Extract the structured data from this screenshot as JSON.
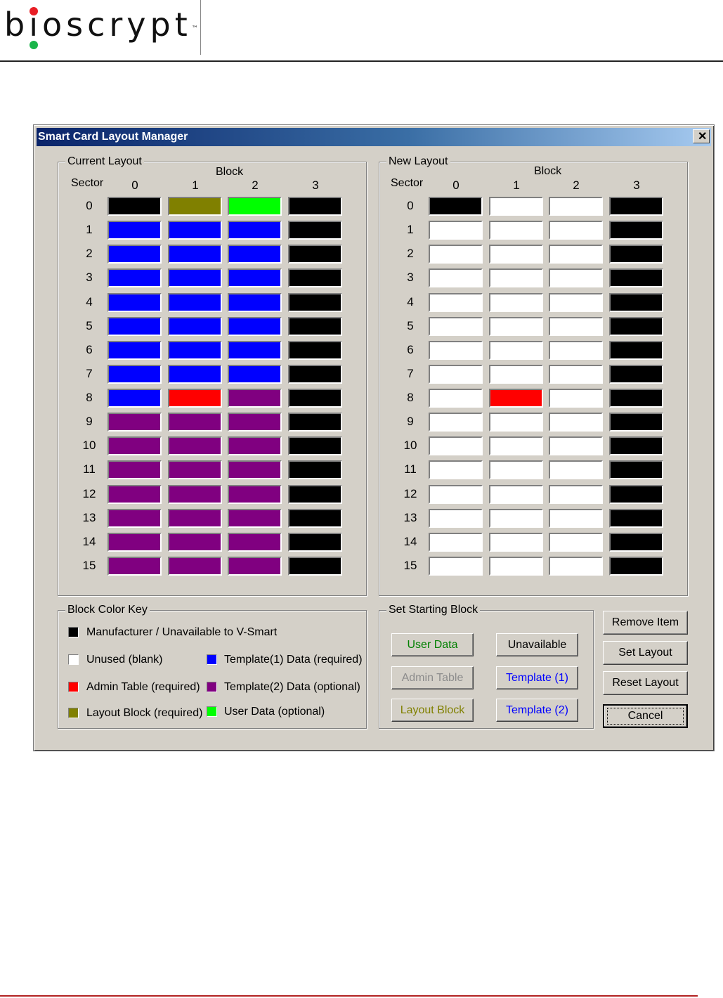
{
  "header": {
    "logo_text": "bioscrypt",
    "logo_tm": "™"
  },
  "dialog": {
    "title": "Smart Card Layout Manager",
    "close_label": "✕",
    "current_layout": {
      "title": "Current Layout",
      "block_label": "Block",
      "sector_label": "Sector",
      "columns": [
        "0",
        "1",
        "2",
        "3"
      ],
      "rows": [
        {
          "sector": "0",
          "cells": [
            "#000000",
            "#808000",
            "#00ff00",
            "#000000"
          ]
        },
        {
          "sector": "1",
          "cells": [
            "#0000ff",
            "#0000ff",
            "#0000ff",
            "#000000"
          ]
        },
        {
          "sector": "2",
          "cells": [
            "#0000ff",
            "#0000ff",
            "#0000ff",
            "#000000"
          ]
        },
        {
          "sector": "3",
          "cells": [
            "#0000ff",
            "#0000ff",
            "#0000ff",
            "#000000"
          ]
        },
        {
          "sector": "4",
          "cells": [
            "#0000ff",
            "#0000ff",
            "#0000ff",
            "#000000"
          ]
        },
        {
          "sector": "5",
          "cells": [
            "#0000ff",
            "#0000ff",
            "#0000ff",
            "#000000"
          ]
        },
        {
          "sector": "6",
          "cells": [
            "#0000ff",
            "#0000ff",
            "#0000ff",
            "#000000"
          ]
        },
        {
          "sector": "7",
          "cells": [
            "#0000ff",
            "#0000ff",
            "#0000ff",
            "#000000"
          ]
        },
        {
          "sector": "8",
          "cells": [
            "#0000ff",
            "#ff0000",
            "#800080",
            "#000000"
          ]
        },
        {
          "sector": "9",
          "cells": [
            "#800080",
            "#800080",
            "#800080",
            "#000000"
          ]
        },
        {
          "sector": "10",
          "cells": [
            "#800080",
            "#800080",
            "#800080",
            "#000000"
          ]
        },
        {
          "sector": "11",
          "cells": [
            "#800080",
            "#800080",
            "#800080",
            "#000000"
          ]
        },
        {
          "sector": "12",
          "cells": [
            "#800080",
            "#800080",
            "#800080",
            "#000000"
          ]
        },
        {
          "sector": "13",
          "cells": [
            "#800080",
            "#800080",
            "#800080",
            "#000000"
          ]
        },
        {
          "sector": "14",
          "cells": [
            "#800080",
            "#800080",
            "#800080",
            "#000000"
          ]
        },
        {
          "sector": "15",
          "cells": [
            "#800080",
            "#800080",
            "#800080",
            "#000000"
          ]
        }
      ]
    },
    "new_layout": {
      "title": "New Layout",
      "block_label": "Block",
      "sector_label": "Sector",
      "columns": [
        "0",
        "1",
        "2",
        "3"
      ],
      "rows": [
        {
          "sector": "0",
          "cells": [
            "#000000",
            "#ffffff",
            "#ffffff",
            "#000000"
          ]
        },
        {
          "sector": "1",
          "cells": [
            "#ffffff",
            "#ffffff",
            "#ffffff",
            "#000000"
          ]
        },
        {
          "sector": "2",
          "cells": [
            "#ffffff",
            "#ffffff",
            "#ffffff",
            "#000000"
          ]
        },
        {
          "sector": "3",
          "cells": [
            "#ffffff",
            "#ffffff",
            "#ffffff",
            "#000000"
          ]
        },
        {
          "sector": "4",
          "cells": [
            "#ffffff",
            "#ffffff",
            "#ffffff",
            "#000000"
          ]
        },
        {
          "sector": "5",
          "cells": [
            "#ffffff",
            "#ffffff",
            "#ffffff",
            "#000000"
          ]
        },
        {
          "sector": "6",
          "cells": [
            "#ffffff",
            "#ffffff",
            "#ffffff",
            "#000000"
          ]
        },
        {
          "sector": "7",
          "cells": [
            "#ffffff",
            "#ffffff",
            "#ffffff",
            "#000000"
          ]
        },
        {
          "sector": "8",
          "cells": [
            "#ffffff",
            "#ff0000",
            "#ffffff",
            "#000000"
          ]
        },
        {
          "sector": "9",
          "cells": [
            "#ffffff",
            "#ffffff",
            "#ffffff",
            "#000000"
          ]
        },
        {
          "sector": "10",
          "cells": [
            "#ffffff",
            "#ffffff",
            "#ffffff",
            "#000000"
          ]
        },
        {
          "sector": "11",
          "cells": [
            "#ffffff",
            "#ffffff",
            "#ffffff",
            "#000000"
          ]
        },
        {
          "sector": "12",
          "cells": [
            "#ffffff",
            "#ffffff",
            "#ffffff",
            "#000000"
          ]
        },
        {
          "sector": "13",
          "cells": [
            "#ffffff",
            "#ffffff",
            "#ffffff",
            "#000000"
          ]
        },
        {
          "sector": "14",
          "cells": [
            "#ffffff",
            "#ffffff",
            "#ffffff",
            "#000000"
          ]
        },
        {
          "sector": "15",
          "cells": [
            "#ffffff",
            "#ffffff",
            "#ffffff",
            "#000000"
          ]
        }
      ]
    },
    "color_key": {
      "title": "Block Color Key",
      "items": [
        {
          "label": "Manufacturer / Unavailable to V-Smart",
          "color": "#000000"
        },
        {
          "label": "Unused (blank)",
          "color": "#ffffff"
        },
        {
          "label": "Template(1) Data (required)",
          "color": "#0000ff"
        },
        {
          "label": "Admin Table (required)",
          "color": "#ff0000"
        },
        {
          "label": "Template(2) Data (optional)",
          "color": "#800080"
        },
        {
          "label": "Layout Block (required)",
          "color": "#808000"
        },
        {
          "label": "User Data (optional)",
          "color": "#00ff00"
        }
      ]
    },
    "starting_block": {
      "title": "Set Starting Block",
      "buttons": [
        {
          "label": "User Data",
          "color": "#008000"
        },
        {
          "label": "Unavailable",
          "color": "#000000"
        },
        {
          "label": "Admin Table",
          "color": "#8c8c8c"
        },
        {
          "label": "Template (1)",
          "color": "#0000ff"
        },
        {
          "label": "Layout Block",
          "color": "#808000"
        },
        {
          "label": "Template (2)",
          "color": "#0000ff"
        }
      ]
    },
    "actions": {
      "remove_item": "Remove Item",
      "set_layout": "Set Layout",
      "reset_layout": "Reset Layout",
      "cancel": "Cancel"
    }
  }
}
